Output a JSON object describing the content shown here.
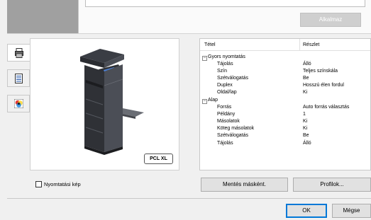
{
  "top": {
    "apply_label": "Alkalmaz"
  },
  "sidebar": {
    "tabs": [
      {
        "icon": "printer-setup-icon",
        "active": true
      },
      {
        "icon": "document-icon",
        "active": false
      },
      {
        "icon": "color-icon",
        "active": false
      }
    ]
  },
  "preview": {
    "image": "multifunction-printer-image",
    "badge": "PCL XL"
  },
  "properties": {
    "columns": [
      "Tétel",
      "Részlet"
    ],
    "rows": [
      {
        "name": "Gyors nyomtatás",
        "value": "",
        "group": true
      },
      {
        "name": "Tájolás",
        "value": "Álló",
        "group": false
      },
      {
        "name": "Szín",
        "value": "Teljes színskála",
        "group": false
      },
      {
        "name": "Szétválogatás",
        "value": "Be",
        "group": false
      },
      {
        "name": "Duplex",
        "value": "Hosszú élen fordul",
        "group": false
      },
      {
        "name": "Oldal/lap",
        "value": "Ki",
        "group": false
      },
      {
        "name": "Alap",
        "value": "",
        "group": true
      },
      {
        "name": "Forrás",
        "value": "Auto forrás választás",
        "group": false
      },
      {
        "name": "Példány",
        "value": "1",
        "group": false
      },
      {
        "name": "Másolatok",
        "value": "Ki",
        "group": false
      },
      {
        "name": "Köteg másolatok",
        "value": "Ki",
        "group": false
      },
      {
        "name": "Szétválogatás",
        "value": "Be",
        "group": false
      },
      {
        "name": "Tájolás",
        "value": "Álló",
        "group": false
      }
    ]
  },
  "print_image_checkbox": {
    "label": "Nyomtatási kép",
    "checked": false
  },
  "buttons": {
    "save_as": "Mentés másként.",
    "profiles": "Profilok...",
    "ok": "OK",
    "cancel": "Mégse"
  }
}
